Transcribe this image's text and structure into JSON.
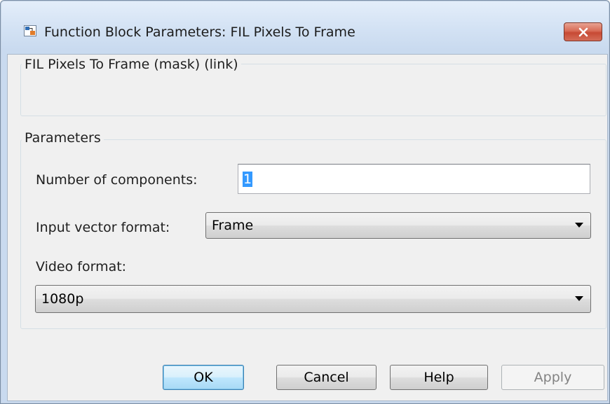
{
  "window": {
    "title": "Function Block Parameters: FIL Pixels To Frame",
    "close_icon": "close-icon",
    "app_icon": "simulink-block-icon"
  },
  "mask_group": {
    "label": "FIL Pixels To Frame (mask) (link)"
  },
  "parameters_group": {
    "label": "Parameters",
    "num_components": {
      "label": "Number of components:",
      "value": "1"
    },
    "input_vector_format": {
      "label": "Input vector format:",
      "value": "Frame"
    },
    "video_format": {
      "label": "Video format:",
      "value": "1080p"
    }
  },
  "buttons": {
    "ok": "OK",
    "cancel": "Cancel",
    "help": "Help",
    "apply": "Apply"
  },
  "colors": {
    "title_bar": "#d3e2f4",
    "close_button": "#c74a34",
    "default_button_border": "#3c7fb1",
    "selection": "#3399ff"
  }
}
